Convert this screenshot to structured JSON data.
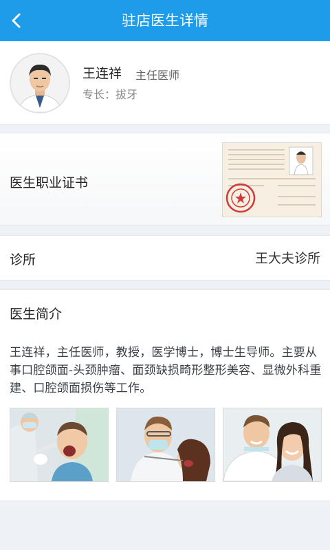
{
  "header": {
    "title": "驻店医生详情"
  },
  "doctor": {
    "name": "王连祥",
    "title": "主任医师",
    "specialty": "专长：拔牙"
  },
  "certificate": {
    "label": "医生职业证书"
  },
  "clinic": {
    "label": "诊所",
    "value": "王大夫诊所"
  },
  "intro": {
    "label": "医生简介",
    "text": "王连祥，主任医师，教授，医学博士，博士生导师。主要从事口腔颌面-头颈肿瘤、面颈缺损畸形整形美容、显微外科重建、口腔颌面损伤等工作。"
  },
  "colors": {
    "accent": "#1e9be9",
    "background": "#eef1f5",
    "seal": "#d03a3a"
  }
}
